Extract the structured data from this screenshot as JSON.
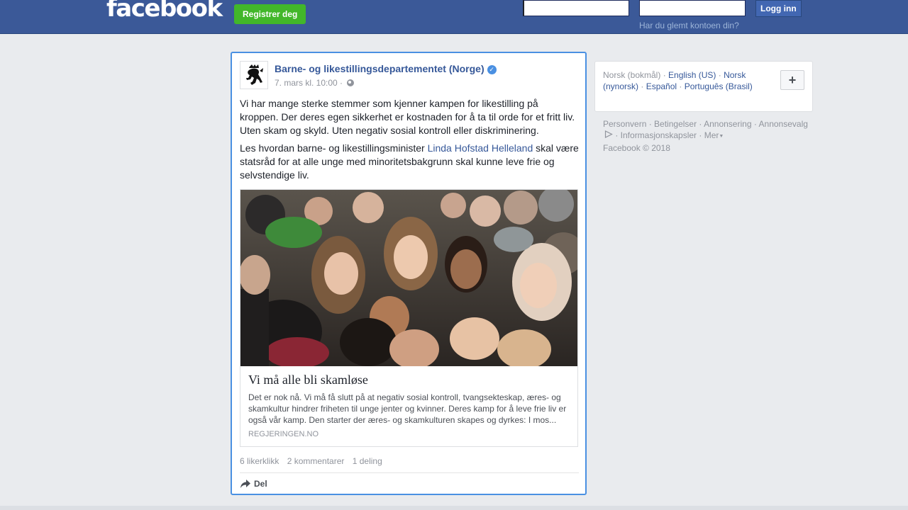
{
  "header": {
    "logo": "facebook",
    "register_label": "Registrer deg",
    "login_label": "Logg inn",
    "forgot_label": "Har du glemt kontoen din?",
    "email_value": "",
    "password_value": "",
    "brand_color": "#3b5998",
    "register_color": "#42b72a"
  },
  "post": {
    "page_name": "Barne- og likestillingsdepartementet (Norge)",
    "verified_icon": "verified-check-icon",
    "timestamp": "7. mars kl. 10:00 ·",
    "privacy_icon": "globe-icon",
    "paragraph1": "Vi har mange sterke stemmer som kjenner kampen for likestilling på kroppen. Der deres egen sikkerhet er kostnaden for å ta til orde for et fritt liv. Uten skam og skyld. Uten negativ sosial kontroll eller diskriminering.",
    "paragraph2_before": "Les hvordan barne- og likestillingsminister ",
    "paragraph2_link": "Linda Hofstad Helleland",
    "paragraph2_after": " skal være statsråd for at alle unge med minoritetsbakgrunn skal kunne leve frie og selvstendige liv.",
    "link_card": {
      "title": "Vi må alle bli skamløse",
      "description": "Det er nok nå. Vi må få slutt på at negativ sosial kontroll, tvangsekteskap, æres- og skamkultur hindrer friheten til unge jenter og kvinner. Deres kamp for å leve frie liv er også vår kamp. Den starter der æres- og skamkulturen skapes og dyrkes: I mos...",
      "domain": "REGJERINGEN.NO"
    },
    "counts": {
      "likes": "6 likerklikk",
      "comments": "2 kommentarer",
      "shares": "1 deling"
    },
    "share_label": "Del",
    "share_icon": "share-arrow-icon"
  },
  "sidebar": {
    "languages": {
      "current": "Norsk (bokmål)",
      "options": [
        "English (US)",
        "Norsk (nynorsk)",
        "Español",
        "Português (Brasil)"
      ],
      "add_label": "+"
    },
    "footer": {
      "links": [
        "Personvern",
        "Betingelser",
        "Annonsering",
        "Annonsevalg",
        "Informasjonskapsler",
        "Mer"
      ],
      "copyright": "Facebook © 2018"
    }
  }
}
